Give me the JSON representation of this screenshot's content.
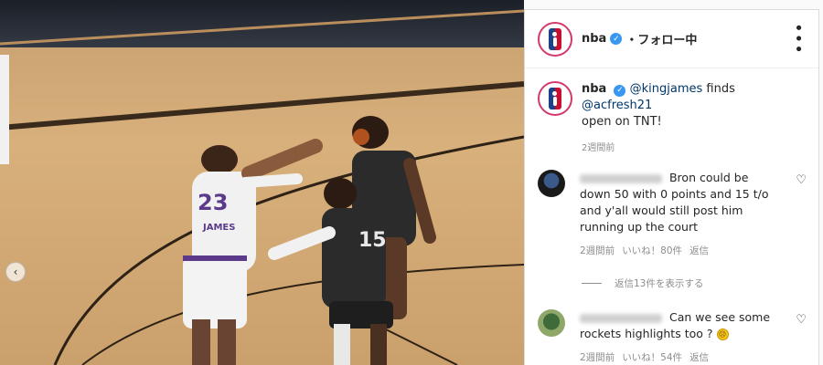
{
  "post": {
    "username": "nba",
    "follow_status": "・フォロー中",
    "caption": {
      "username": "nba",
      "mention1": "@kingjames",
      "text_mid": " finds ",
      "mention2": "@acfresh21",
      "text_end": "open on TNT!"
    },
    "caption_time": "2週間前"
  },
  "comments": [
    {
      "text": "Bron could be down 50 with 0 points and 15 t/o and y'all would still post him running up the court",
      "time": "2週間前",
      "likes": "いいね！80件",
      "reply": "返信"
    },
    {
      "text": "Can we see some rockets highlights too ?",
      "time": "2週間前",
      "likes": "いいね！54件",
      "reply": "返信"
    }
  ],
  "replies_toggle": "返信13件を表示する",
  "colors": {
    "mention": "#00376b",
    "verified": "#3897f0",
    "muted": "#8e8e8e"
  },
  "icons": [
    "verified-icon",
    "more-icon",
    "heart-icon",
    "carousel-prev-icon",
    "emoji-icon"
  ]
}
